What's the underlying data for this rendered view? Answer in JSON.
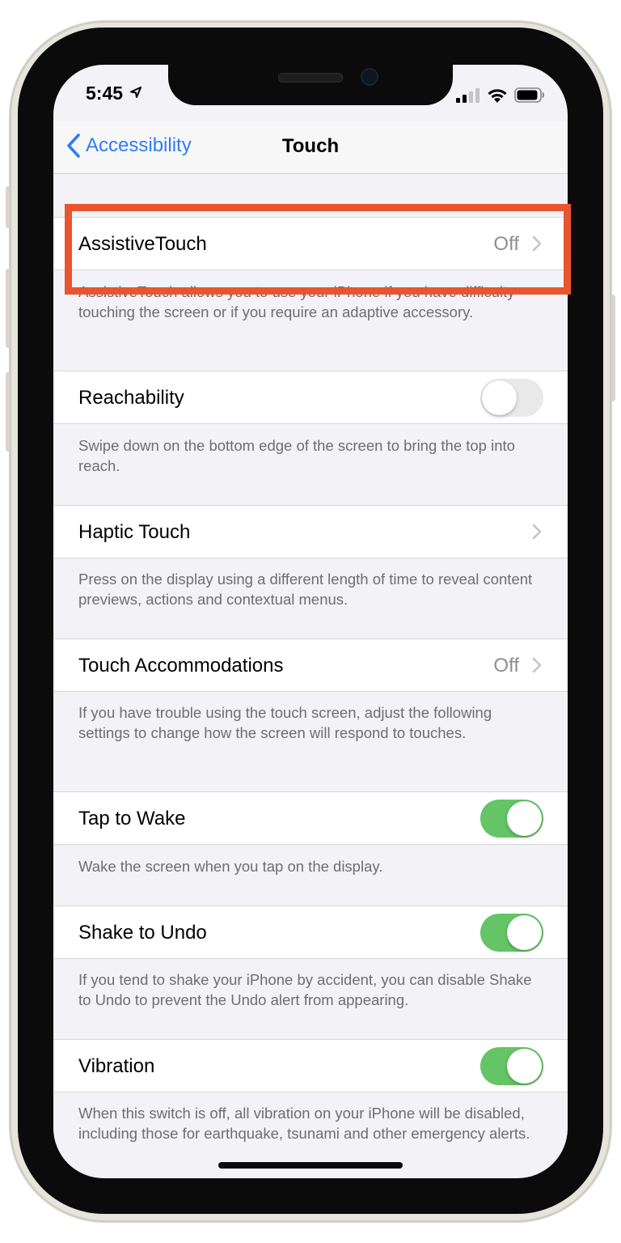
{
  "status_bar": {
    "time": "5:45",
    "location_icon": "location-arrow-icon",
    "signal_icon": "cellular-signal-icon",
    "wifi_icon": "wifi-icon",
    "battery_icon": "battery-icon"
  },
  "nav": {
    "back_label": "Accessibility",
    "title": "Touch",
    "accent_color": "#2f7cf6"
  },
  "sections": [
    {
      "label": "AssistiveTouch",
      "value": "Off",
      "footer": "AssistiveTouch allows you to use your iPhone if you have difficulty touching the screen or if you require an adaptive accessory."
    },
    {
      "label": "Reachability",
      "toggle_on": false,
      "footer": "Swipe down on the bottom edge of the screen to bring the top into reach."
    },
    {
      "label": "Haptic Touch",
      "footer": "Press on the display using a different length of time to reveal content previews, actions and contextual menus."
    },
    {
      "label": "Touch Accommodations",
      "value": "Off",
      "footer": "If you have trouble using the touch screen, adjust the following settings to change how the screen will respond to touches."
    },
    {
      "label": "Tap to Wake",
      "toggle_on": true,
      "footer": "Wake the screen when you tap on the display."
    },
    {
      "label": "Shake to Undo",
      "toggle_on": true,
      "footer": "If you tend to shake your iPhone by accident, you can disable Shake to Undo to prevent the Undo alert from appearing."
    },
    {
      "label": "Vibration",
      "toggle_on": true,
      "footer": "When this switch is off, all vibration on your iPhone will be disabled, including those for earthquake, tsunami and other emergency alerts."
    }
  ],
  "colors": {
    "toggle_on": "#64c466",
    "toggle_off": "#e9e9ea",
    "highlight_box": "#e9552f",
    "background": "#f2f2f7"
  }
}
